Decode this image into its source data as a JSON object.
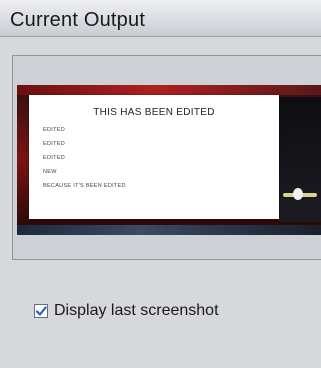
{
  "header": {
    "title": "Current Output"
  },
  "preview": {
    "document_title": "THIS HAS BEEN EDITED",
    "document_lines": [
      "EDITED",
      "EDITED",
      "EDITED",
      "NEW",
      "BECAUSE IT'S BEEN EDITED"
    ]
  },
  "options": {
    "display_last_screenshot_label": "Display last screenshot",
    "display_last_screenshot_checked": true
  }
}
